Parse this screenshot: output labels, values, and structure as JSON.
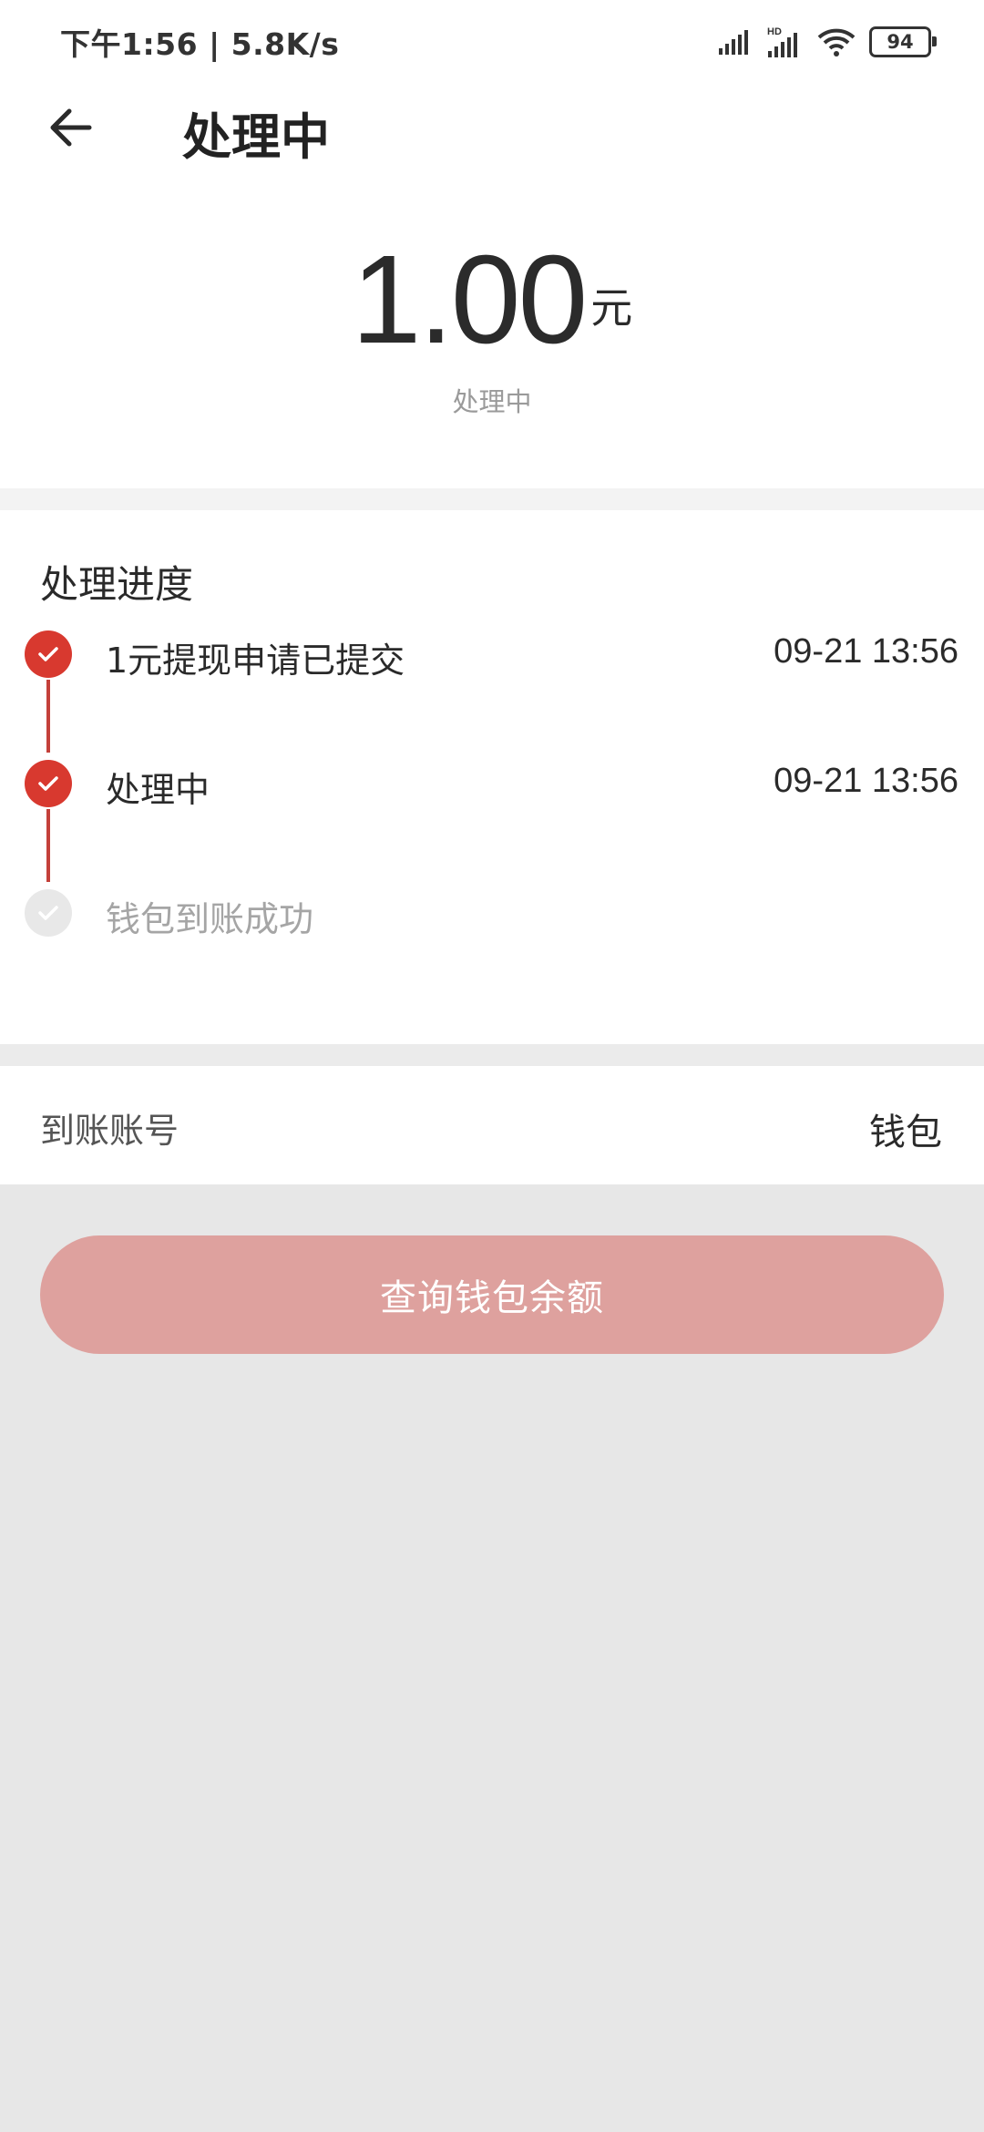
{
  "status_bar": {
    "time_speed": "下午1:56 | 5.8K/s",
    "battery": "94",
    "hd_label": "HD"
  },
  "header": {
    "title": "处理中"
  },
  "amount": {
    "value": "1.00",
    "unit": "元",
    "status": "处理中"
  },
  "progress": {
    "title": "处理进度",
    "steps": [
      {
        "label": "1元提现申请已提交",
        "time": "09-21 13:56",
        "done": true
      },
      {
        "label": "处理中",
        "time": "09-21 13:56",
        "done": true
      },
      {
        "label": "钱包到账成功",
        "time": "",
        "done": false
      }
    ]
  },
  "account": {
    "label": "到账账号",
    "value": "钱包"
  },
  "cta": {
    "label": "查询钱包余额"
  },
  "colors": {
    "accent": "#d8392f",
    "button_bg": "#dea19e",
    "page_bg": "#e7e7e7"
  }
}
